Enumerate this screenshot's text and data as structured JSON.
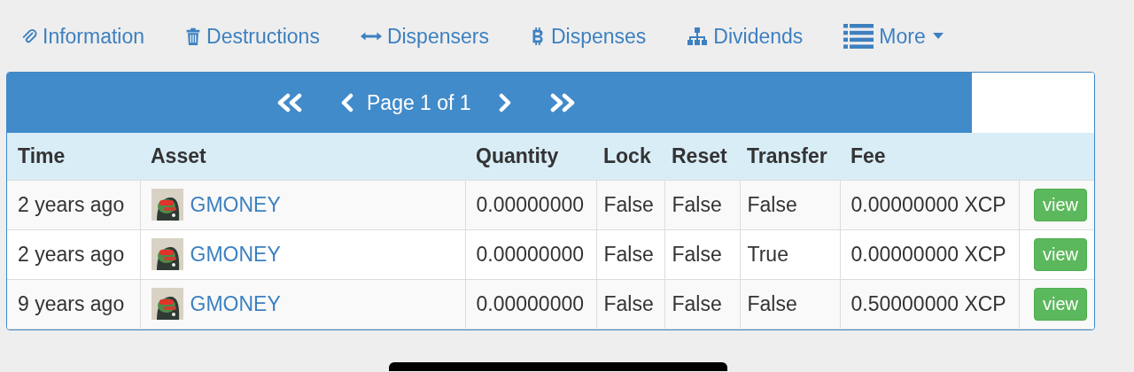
{
  "nav": [
    {
      "label": "Information"
    },
    {
      "label": "Destructions"
    },
    {
      "label": "Dispensers"
    },
    {
      "label": "Dispenses"
    },
    {
      "label": "Dividends"
    },
    {
      "label": "More",
      "dropdown": true
    }
  ],
  "pager": {
    "text": "Page 1 of 1"
  },
  "table": {
    "columns": [
      "Time",
      "Asset",
      "Quantity",
      "Lock",
      "Reset",
      "Transfer",
      "Fee"
    ],
    "rows": [
      {
        "time": "2 years ago",
        "asset": "GMONEY",
        "quantity": "0.00000000",
        "lock": "False",
        "reset": "False",
        "transfer": "False",
        "fee": "0.00000000 XCP",
        "action": "view"
      },
      {
        "time": "2 years ago",
        "asset": "GMONEY",
        "quantity": "0.00000000",
        "lock": "False",
        "reset": "False",
        "transfer": "True",
        "fee": "0.00000000 XCP",
        "action": "view"
      },
      {
        "time": "9 years ago",
        "asset": "GMONEY",
        "quantity": "0.00000000",
        "lock": "False",
        "reset": "False",
        "transfer": "False",
        "fee": "0.50000000 XCP",
        "action": "view"
      }
    ]
  }
}
